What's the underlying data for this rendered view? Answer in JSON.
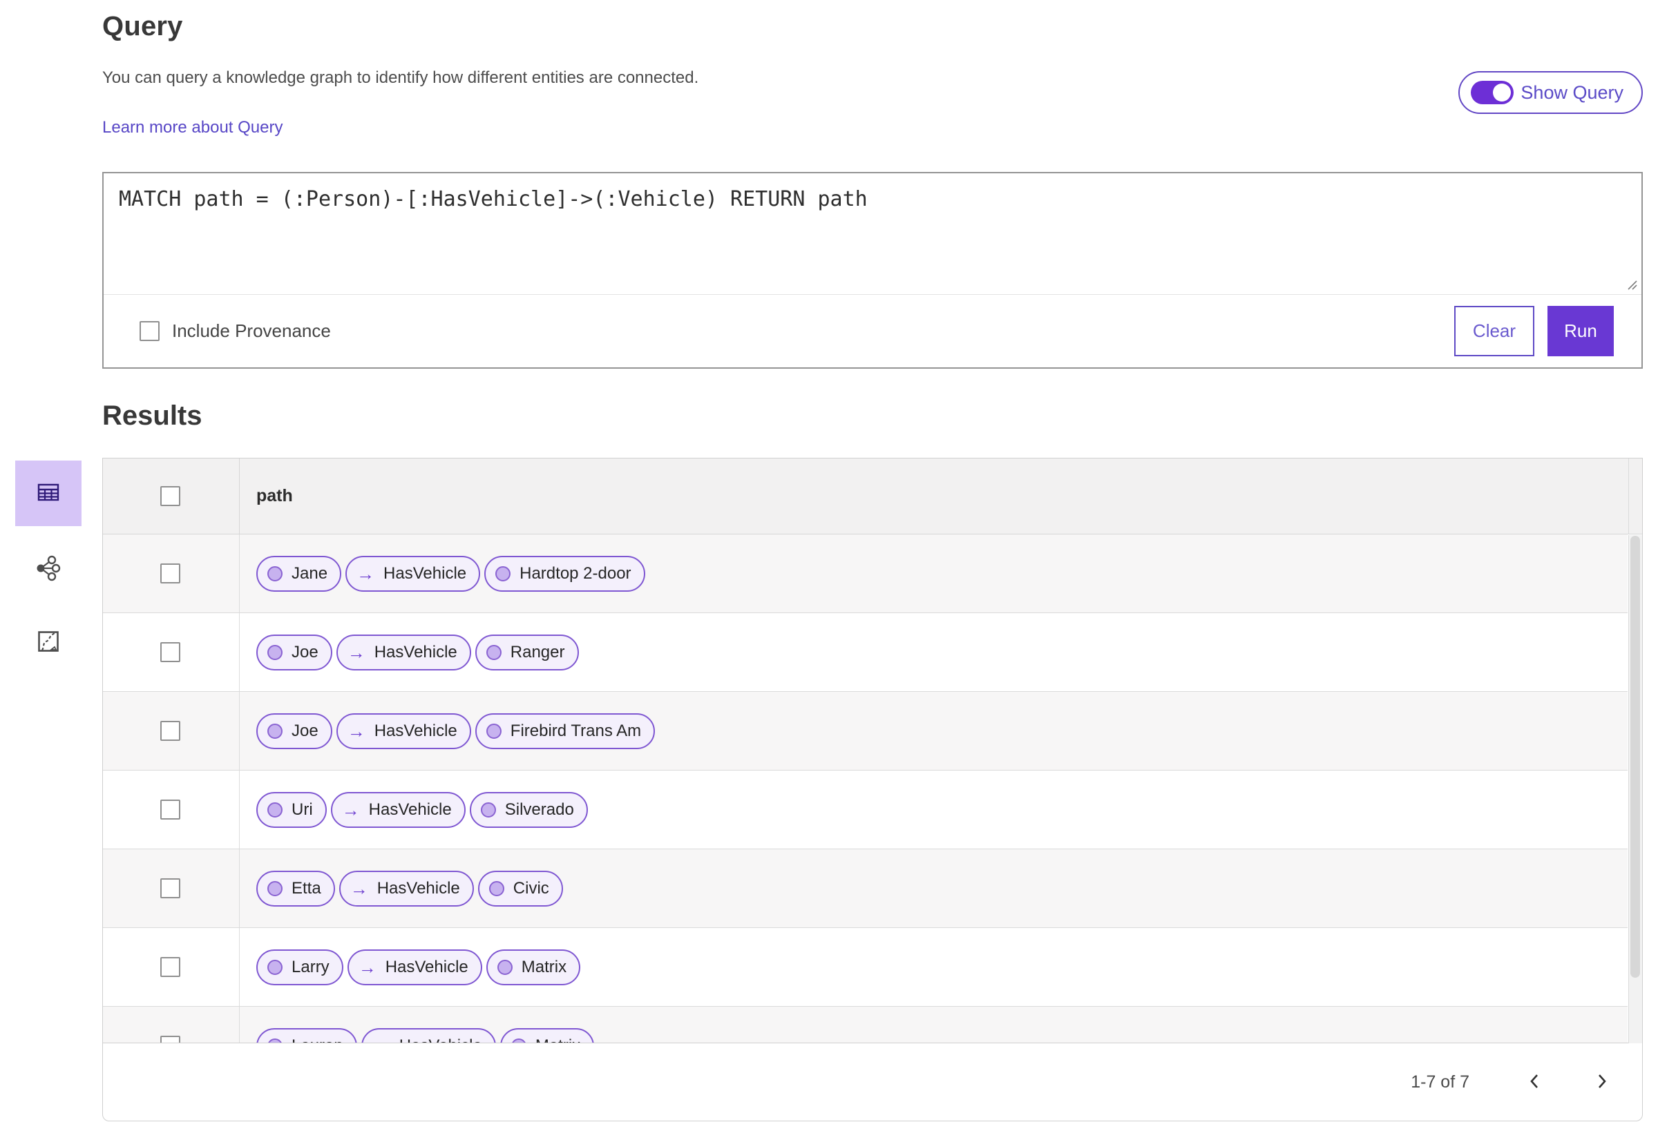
{
  "page": {
    "title": "Query",
    "description": "You can query a knowledge graph to identify how different entities are connected.",
    "learn_more_label": "Learn more about Query",
    "show_query": {
      "label": "Show Query",
      "state": "on"
    }
  },
  "query_editor": {
    "text": "MATCH path = (:Person)-[:HasVehicle]->(:Vehicle) RETURN path",
    "include_provenance": {
      "label": "Include Provenance",
      "checked": false
    },
    "buttons": {
      "clear": "Clear",
      "run": "Run"
    }
  },
  "results": {
    "title": "Results",
    "view_switcher": [
      {
        "id": "table-view",
        "icon": "table-icon",
        "selected": true
      },
      {
        "id": "graph-view",
        "icon": "graph-icon",
        "selected": false
      },
      {
        "id": "map-view",
        "icon": "map-icon",
        "selected": false
      }
    ],
    "table": {
      "columns": [
        "path"
      ],
      "relationship_arrow": "→",
      "rows": [
        {
          "source": "Jane",
          "relationship": "HasVehicle",
          "target": "Hardtop 2-door"
        },
        {
          "source": "Joe",
          "relationship": "HasVehicle",
          "target": "Ranger"
        },
        {
          "source": "Joe",
          "relationship": "HasVehicle",
          "target": "Firebird Trans Am"
        },
        {
          "source": "Uri",
          "relationship": "HasVehicle",
          "target": "Silverado"
        },
        {
          "source": "Etta",
          "relationship": "HasVehicle",
          "target": "Civic"
        },
        {
          "source": "Larry",
          "relationship": "HasVehicle",
          "target": "Matrix"
        },
        {
          "source": "Lauren",
          "relationship": "HasVehicle",
          "target": "Matrix"
        }
      ]
    },
    "pagination": {
      "range_label": "1-7 of 7"
    }
  },
  "colors": {
    "accent_purple": "#6938d3",
    "toggle_purple": "#6d2fd6",
    "pill_border": "#7f57d2",
    "pill_background": "#f4f0fc",
    "node_fill": "#c7b2ef",
    "selected_view_background": "#d6c5f7",
    "link": "#5746c6",
    "table_header_background": "#f2f1f1",
    "row_stripe": "#f7f6f6"
  }
}
